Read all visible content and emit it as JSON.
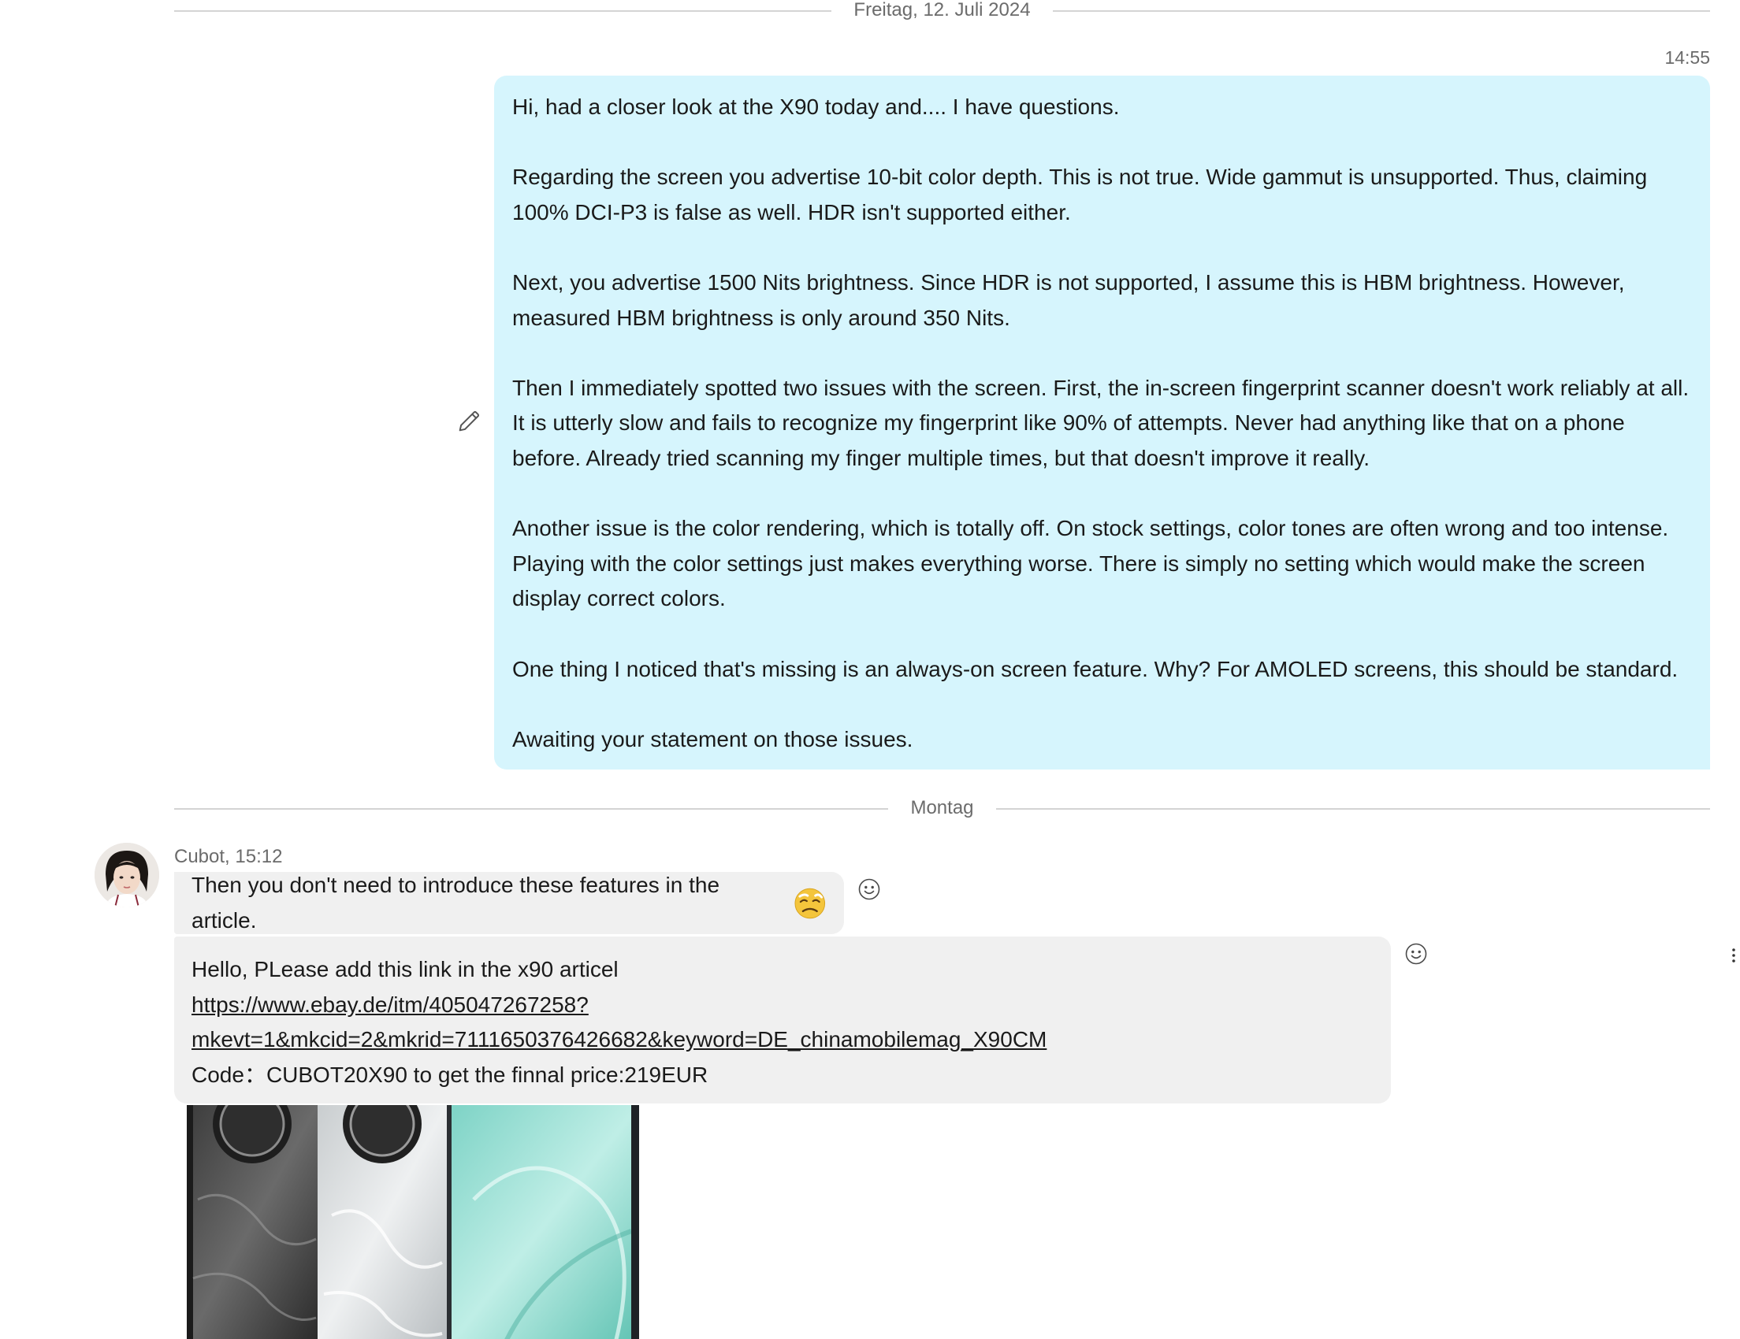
{
  "separators": {
    "first": "Freitag, 12. Juli 2024",
    "second": "Montag"
  },
  "outgoing": {
    "time": "14:55",
    "paragraphs": [
      "Hi, had a closer look at the X90 today and.... I have questions.",
      "Regarding the screen you advertise 10-bit color depth. This is not true. Wide gammut is unsupported. Thus, claiming 100% DCI-P3 is false as well. HDR isn't supported either.",
      "Next, you advertise 1500 Nits brightness. Since HDR is not supported, I assume this is HBM brightness. However, measured HBM brightness is only around 350 Nits.",
      "Then I immediately spotted two issues with the screen. First, the in-screen fingerprint scanner doesn't work reliably at all. It is utterly slow and fails to recognize my fingerprint like 90% of attempts. Never had anything like that on a phone before. Already tried scanning my finger multiple times, but that doesn't improve it really.",
      "Another issue is the color rendering, which is totally off. On stock settings, color tones are often wrong and too intense. Playing with the color settings just makes everything worse. There is simply no setting which would make the screen display correct colors.",
      "One thing I noticed that's missing is an always-on screen feature. Why? For AMOLED screens, this should be standard.",
      "Awaiting your statement on those issues."
    ]
  },
  "incoming": {
    "sender_line": "Cubot, 15:12",
    "message1": "Then you don't need to introduce these features in the article.",
    "message1_emoji": "tired-face-emoji",
    "message2": {
      "line1": "Hello, PLease add this link in the x90 articel",
      "link_part1": "https://www.ebay.de/itm/405047267258?",
      "link_part2": "mkevt=1&mkcid=2&mkrid=7111650376426682&keyword=DE_chinamobilemag_X90CM",
      "line3": "Code：CUBOT20X90 to get the finnal price:219EUR"
    },
    "attachment": "image-attachment-phone-photo"
  },
  "icons": {
    "edit": "pencil-icon",
    "react": "smiley-icon",
    "more": "more-vertical-icon"
  },
  "colors": {
    "outgoing_bubble": "#d6f5fd",
    "incoming_bubble": "#f0f0f0",
    "separator_line": "#d4d4d4",
    "meta_text": "#6b6b6b"
  }
}
